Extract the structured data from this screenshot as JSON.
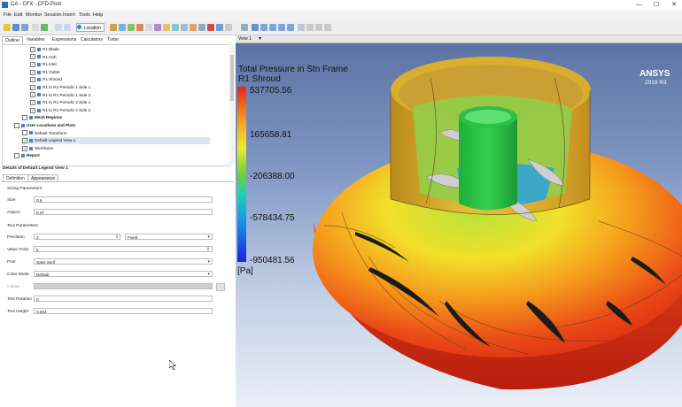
{
  "window": {
    "title": "CA - CFX - CFD-Post",
    "controls": [
      "—",
      "☐",
      "✕"
    ]
  },
  "menu": [
    "File",
    "Edit",
    "Monitor",
    "Session",
    "Insert",
    "Tools",
    "Help"
  ],
  "toolbar": {
    "location_label": "Location"
  },
  "left_tabs": [
    "Outline",
    "Variables",
    "Expressions",
    "Calculators",
    "Turbo"
  ],
  "tree": [
    {
      "label": "R1 Blade",
      "indent": 3,
      "checked": true
    },
    {
      "label": "R1 Hub",
      "indent": 3,
      "checked": true
    },
    {
      "label": "R1 Inlet",
      "indent": 3,
      "checked": true
    },
    {
      "label": "R1 Outlet",
      "indent": 3,
      "checked": true
    },
    {
      "label": "R1 Shroud",
      "indent": 3,
      "checked": true
    },
    {
      "label": "R1 to R1 Periodic 1 Side 1",
      "indent": 3,
      "checked": true
    },
    {
      "label": "R1 to R1 Periodic 1 Side 2",
      "indent": 3,
      "checked": true
    },
    {
      "label": "R1 to R1 Periodic 2 Side 1",
      "indent": 3,
      "checked": true
    },
    {
      "label": "R1 to R1 Periodic 2 Side 2",
      "indent": 3,
      "checked": true
    },
    {
      "label": "Mesh Regions",
      "indent": 2,
      "checked": false,
      "bold": true
    },
    {
      "label": "User Locations and Plots",
      "indent": 1,
      "checked": false,
      "bold": true
    },
    {
      "label": "Default Transform",
      "indent": 2,
      "checked": false
    },
    {
      "label": "Default Legend View 1",
      "indent": 2,
      "checked": true,
      "selected": true
    },
    {
      "label": "Wireframe",
      "indent": 2,
      "checked": true
    },
    {
      "label": "Report",
      "indent": 1,
      "checked": false,
      "bold": true
    }
  ],
  "details": {
    "title": "Details of Default Legend View 1",
    "tabs": [
      "Definition",
      "Appearance"
    ],
    "sizing_label": "Sizing Parameters",
    "size_label": "Size",
    "size_value": "0.6",
    "aspect_label": "Aspect",
    "aspect_value": "0.07",
    "text_params_label": "Text Parameters",
    "precision_label": "Precision",
    "precision_value": "2",
    "precision_mode": "Fixed",
    "value_ticks_label": "Value Ticks",
    "value_ticks_value": "5",
    "font_label": "Font",
    "font_value": "Sans Serif",
    "color_mode_label": "Color Mode",
    "color_mode_value": "Default",
    "colour_label": "Colour",
    "text_rotation_label": "Text Rotation",
    "text_rotation_value": "0",
    "text_height_label": "Text Height",
    "text_height_value": "0.024"
  },
  "viewport": {
    "tab_label": "View 1",
    "brand": "ANSYS",
    "brand_version": "2019 R3"
  },
  "legend": {
    "title": "Total Pressure in Stn Frame",
    "subtitle": "R1 Shroud",
    "values": [
      "537705.56",
      "165658.81",
      "-206388.00",
      "-578434.75",
      "-950481.56"
    ],
    "unit": "[Pa]"
  },
  "colors": {
    "accent": "#2d6db5",
    "legend_top": "#e8221a",
    "legend_bottom": "#1a22d8"
  }
}
